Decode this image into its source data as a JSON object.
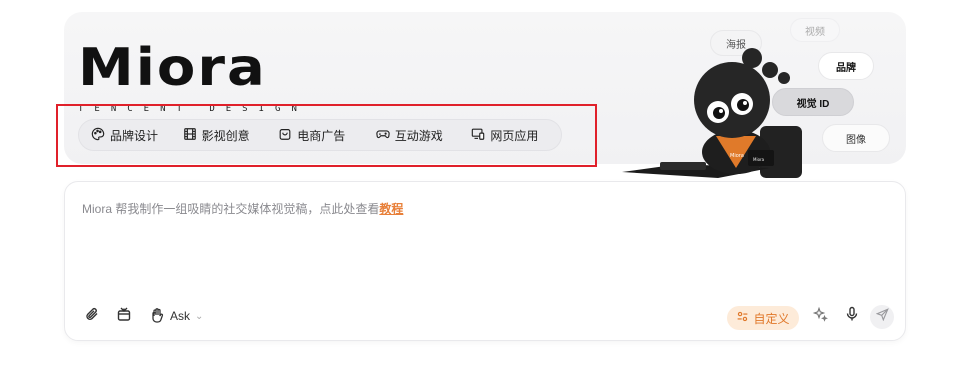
{
  "hero": {
    "logo_text": "Miora",
    "logo_tagline": "TENCENT DESIGN",
    "categories": [
      {
        "label": "品牌设计",
        "icon": "palette-icon"
      },
      {
        "label": "影视创意",
        "icon": "film-icon"
      },
      {
        "label": "电商广告",
        "icon": "shopping-bag-icon"
      },
      {
        "label": "互动游戏",
        "icon": "gamepad-icon"
      },
      {
        "label": "网页应用",
        "icon": "devices-icon"
      }
    ],
    "bubbles": {
      "haibao": "海报",
      "shipin": "视频",
      "pinpai": "品牌",
      "vid": "视觉 ID",
      "tuxiang": "图像"
    },
    "mascot_labels": [
      "Miora",
      "Miora"
    ]
  },
  "input": {
    "prompt_text": "Miora 帮我制作一组吸睛的社交媒体视觉稿，点此处查看",
    "prompt_link": "教程",
    "ask_label": "Ask",
    "custom_label": "自定义"
  },
  "colors": {
    "accent": "#e8803a",
    "highlight": "#e0202a"
  }
}
